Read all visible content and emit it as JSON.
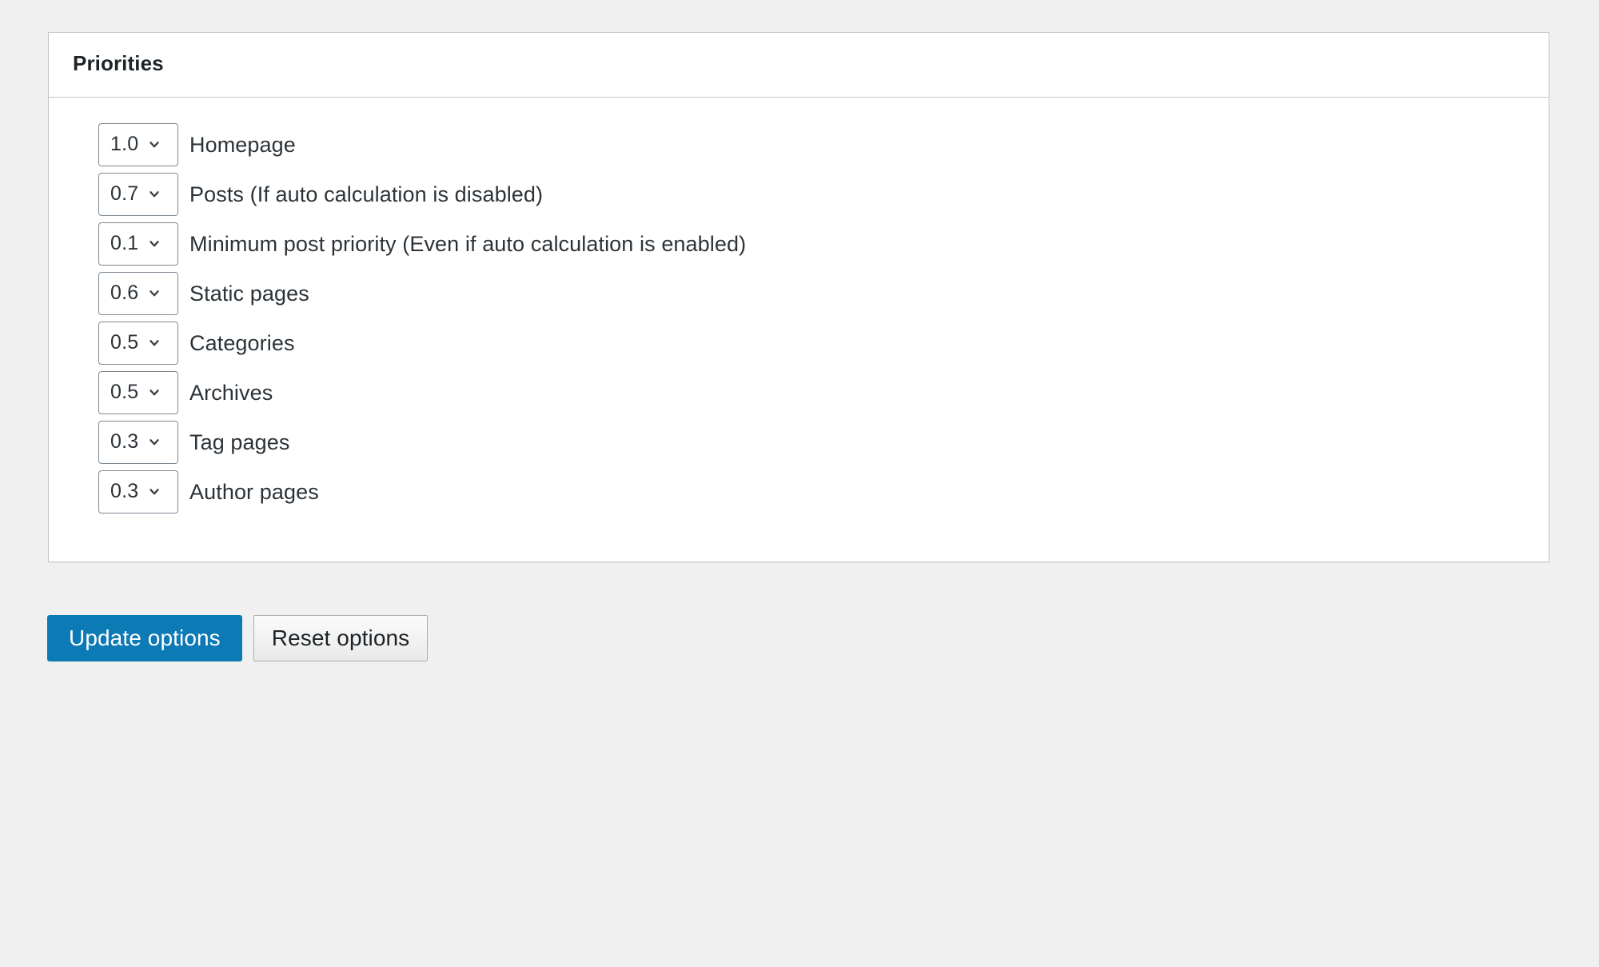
{
  "panel": {
    "title": "Priorities"
  },
  "priorities": [
    {
      "value": "1.0",
      "label": "Homepage",
      "select_name": "priority-homepage"
    },
    {
      "value": "0.7",
      "label": "Posts (If auto calculation is disabled)",
      "select_name": "priority-posts"
    },
    {
      "value": "0.1",
      "label": "Minimum post priority (Even if auto calculation is enabled)",
      "select_name": "priority-minimum-post"
    },
    {
      "value": "0.6",
      "label": "Static pages",
      "select_name": "priority-static-pages"
    },
    {
      "value": "0.5",
      "label": "Categories",
      "select_name": "priority-categories"
    },
    {
      "value": "0.5",
      "label": "Archives",
      "select_name": "priority-archives"
    },
    {
      "value": "0.3",
      "label": "Tag pages",
      "select_name": "priority-tag-pages"
    },
    {
      "value": "0.3",
      "label": "Author pages",
      "select_name": "priority-author-pages"
    }
  ],
  "actions": {
    "update_label": "Update options",
    "reset_label": "Reset options"
  },
  "icons": {
    "dropdown": "chevron-down-icon"
  },
  "colors": {
    "page_background": "#f0f0f1",
    "card_background": "#ffffff",
    "card_border": "#c3c4c7",
    "text": "#2c3338",
    "heading": "#1d2327",
    "select_border": "#7e8993",
    "primary_button": "#0c7ab5",
    "primary_button_text": "#ffffff",
    "secondary_button_border": "#adadad"
  }
}
